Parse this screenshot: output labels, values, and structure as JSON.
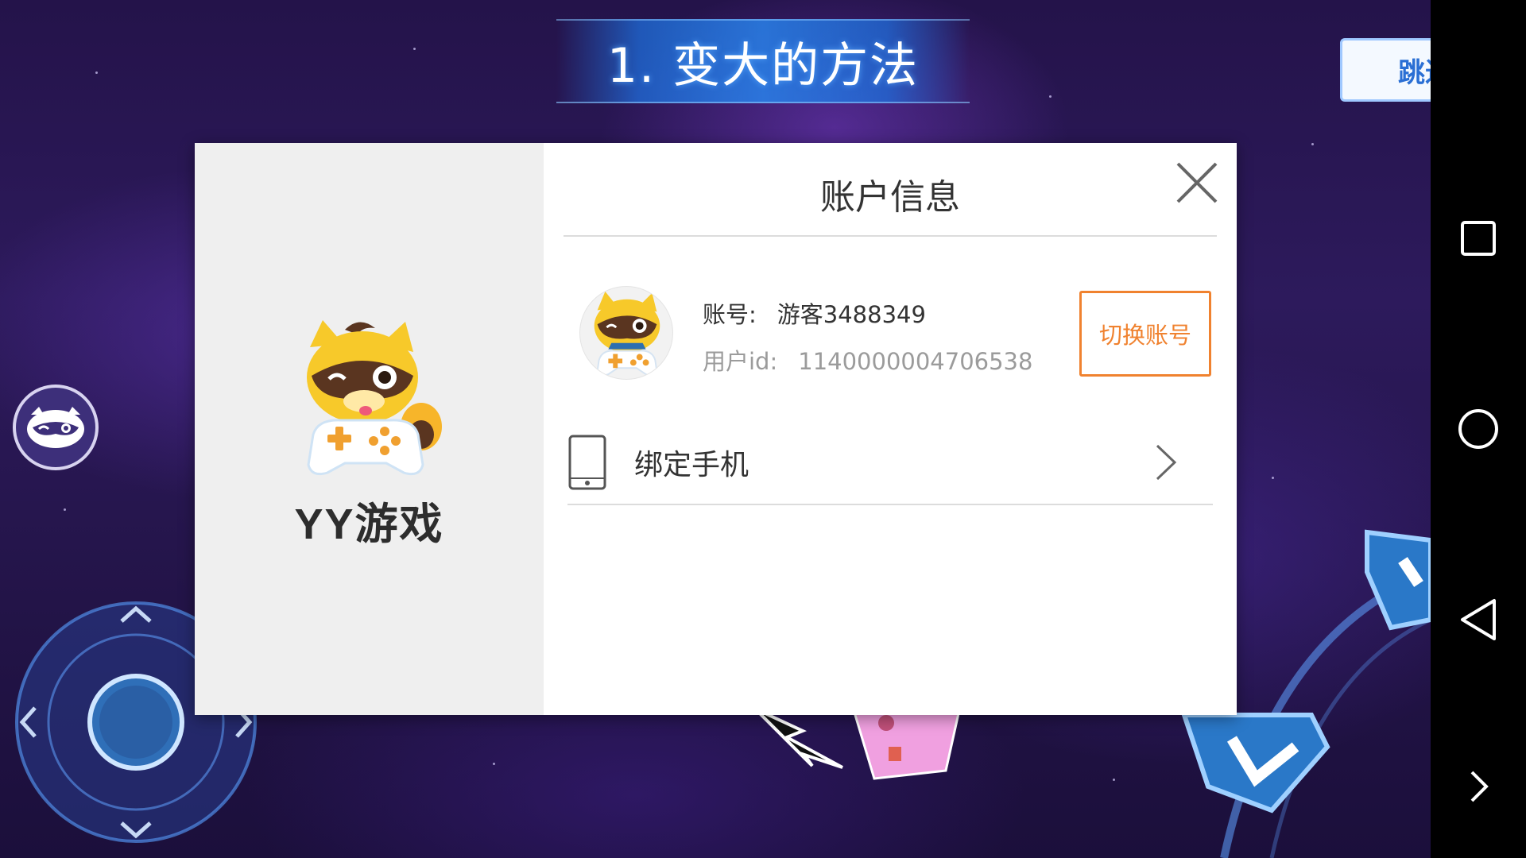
{
  "game": {
    "title": "1. 变大的方法",
    "skip_label": "跳过"
  },
  "dialog": {
    "brand_name": "YY游戏",
    "title": "账户信息",
    "account": {
      "account_label": "账号:",
      "account_value": "游客3488349",
      "userid_label": "用户id:",
      "userid_value": "1140000004706538"
    },
    "switch_account_label": "切换账号",
    "bind_phone_label": "绑定手机"
  },
  "icons": {
    "close": "close-icon",
    "phone": "phone-icon",
    "chevron": "chevron-right-icon",
    "nav_recent": "square-icon",
    "nav_home": "circle-icon",
    "nav_back": "triangle-back-icon",
    "nav_more": "chevron-right-icon"
  },
  "colors": {
    "accent": "#f0822f",
    "text": "#333333",
    "muted": "#9b9b9b",
    "brand_panel": "#efefef"
  }
}
